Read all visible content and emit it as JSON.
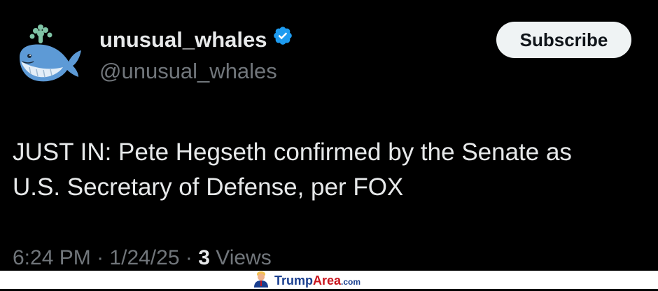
{
  "tweet": {
    "display_name": "unusual_whales",
    "handle": "@unusual_whales",
    "subscribe_label": "Subscribe",
    "text_line1": "JUST IN: Pete Hegseth confirmed by the Senate as",
    "text_line2": "U.S. Secretary of Defense, per FOX",
    "time": "6:24 PM",
    "date": "1/24/25",
    "views_count": "3",
    "views_label": "Views",
    "separator": "·"
  },
  "footer": {
    "brand_trump": "Trump",
    "brand_area": "Area",
    "brand_com": ".com"
  },
  "colors": {
    "background": "#000000",
    "primary_text": "#e7e9ea",
    "secondary_text": "#71767b",
    "verified": "#1d9bf0"
  },
  "icons": {
    "avatar": "whale-icon",
    "verified": "verified-badge-icon",
    "footer_logo": "trump-figure-icon"
  }
}
